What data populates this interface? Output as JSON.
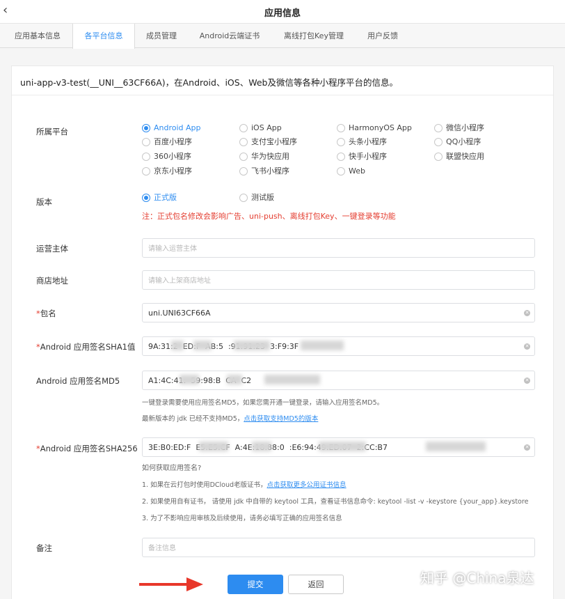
{
  "window": {
    "title": "应用信息"
  },
  "tabs": [
    {
      "label": "应用基本信息"
    },
    {
      "label": "各平台信息"
    },
    {
      "label": "成员管理"
    },
    {
      "label": "Android云端证书"
    },
    {
      "label": "离线打包Key管理"
    },
    {
      "label": "用户反馈"
    }
  ],
  "active_tab": "各平台信息",
  "card": {
    "heading": "uni-app-v3-test(__UNI__63CF66A)，在Android、iOS、Web及微信等各种小程序平台的信息。"
  },
  "platform": {
    "label": "所属平台",
    "selected": "Android App",
    "options": [
      "Android App",
      "iOS App",
      "HarmonyOS App",
      "微信小程序",
      "百度小程序",
      "支付宝小程序",
      "头条小程序",
      "QQ小程序",
      "360小程序",
      "华为快应用",
      "快手小程序",
      "联盟快应用",
      "京东小程序",
      "飞书小程序",
      "Web"
    ]
  },
  "version": {
    "label": "版本",
    "selected": "正式版",
    "options": [
      "正式版",
      "测试版"
    ],
    "warning": "注：正式包名修改会影响广告、uni-push、离线打包Key、一键登录等功能"
  },
  "operator": {
    "label": "运营主体",
    "value": "",
    "placeholder": "请输入运营主体"
  },
  "store": {
    "label": "商店地址",
    "value": "",
    "placeholder": "请输入上架商店地址"
  },
  "package": {
    "label": "包名",
    "value": "uni.UNI63CF66A"
  },
  "sha1": {
    "label": "Android 应用签名SHA1值",
    "value": "9A:31:2  ED:F  AB:5  :91:91:23  3:F9:3F"
  },
  "md5": {
    "label": "Android 应用签名MD5",
    "value": "A1:4C:41:  59:98:B  CA  C2",
    "hint1": "一键登录需要使用应用签名MD5，如果您需开通一键登录，请输入应用签名MD5。",
    "hint2_text": "最新版本的 jdk 已经不支持MD5，",
    "hint2_link": "点击获取支持MD5的版本"
  },
  "sha256": {
    "label": "Android 应用签名SHA256",
    "value": "3E:B0:ED:F  E5:E5:CF  A:4E:18:88:0  :E6:94:49:ED:07  2:CC:B7",
    "help_title": "如何获取应用签名?",
    "help1_text": "1. 如果在云打包时使用DCloud老版证书，",
    "help1_link": "点击获取更多公用证书信息",
    "help2": "2. 如果使用自有证书， 请使用 jdk 中自带的 keytool 工具，查看证书信息命令: keytool -list -v -keystore {your_app}.keystore",
    "help3": "3. 为了不影响应用审核及后续使用，请务必填写正确的应用签名信息"
  },
  "remark": {
    "label": "备注",
    "value": "",
    "placeholder": "备注信息"
  },
  "buttons": {
    "submit": "提交",
    "back": "返回"
  },
  "watermark": "知乎 @China泉达",
  "colors": {
    "accent": "#2d8cf0",
    "warning": "#e43d30",
    "annotation_arrow": "#e8372a"
  }
}
